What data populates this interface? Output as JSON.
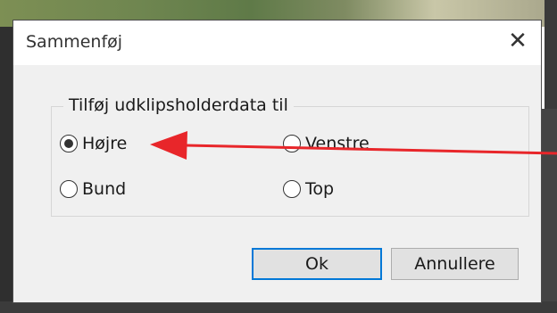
{
  "dialog": {
    "title": "Sammenføj",
    "close_glyph": "✕",
    "group_title": "Tilføj udklipsholderdata til",
    "options": [
      {
        "label": "Højre",
        "selected": true
      },
      {
        "label": "Venstre",
        "selected": false
      },
      {
        "label": "Bund",
        "selected": false
      },
      {
        "label": "Top",
        "selected": false
      }
    ],
    "ok_label": "Ok",
    "cancel_label": "Annullere"
  },
  "colors": {
    "accent": "#0078d7",
    "annotation_arrow": "#e8262a"
  },
  "icons": {
    "close": "close-icon",
    "annotation": "red-arrow-annotation"
  }
}
